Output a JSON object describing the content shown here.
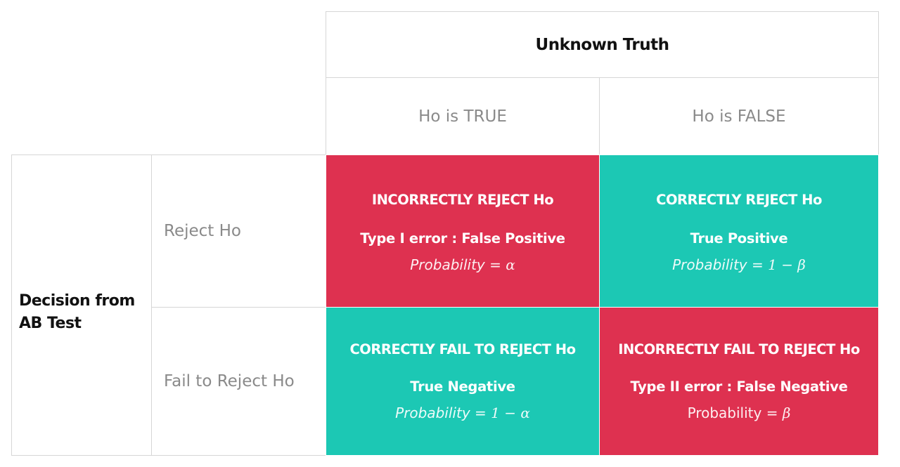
{
  "header": {
    "truth_title": "Unknown Truth",
    "col_true": "Ho is TRUE",
    "col_false": "Ho is FALSE"
  },
  "decision": {
    "label_line1": "Decision from",
    "label_line2": "AB Test",
    "row_reject": "Reject Ho",
    "row_fail": "Fail to Reject Ho"
  },
  "cells": {
    "reject_true": {
      "title": "INCORRECTLY REJECT  Ho",
      "subtitle": "Type I error : False Positive",
      "prob_label": "Probability =",
      "prob_expr": "α"
    },
    "reject_false": {
      "title": "CORRECTLY REJECT  Ho",
      "subtitle": "True Positive",
      "prob_label": "Probability =",
      "prob_expr": "1  − β"
    },
    "fail_true": {
      "title": "CORRECTLY FAIL TO REJECT Ho",
      "subtitle": "True Negative",
      "prob_label": "Probability =",
      "prob_expr": "1 − α"
    },
    "fail_false": {
      "title": "INCORRECTLY FAIL TO REJECT  Ho",
      "subtitle": "Type II error : False Negative",
      "prob_label": "Probability =",
      "prob_expr": "β"
    }
  },
  "colors": {
    "error_red": "#de3150",
    "correct_teal": "#1cc8b4",
    "border_gray": "#d6d6d6",
    "label_gray": "#8a8a8a"
  }
}
